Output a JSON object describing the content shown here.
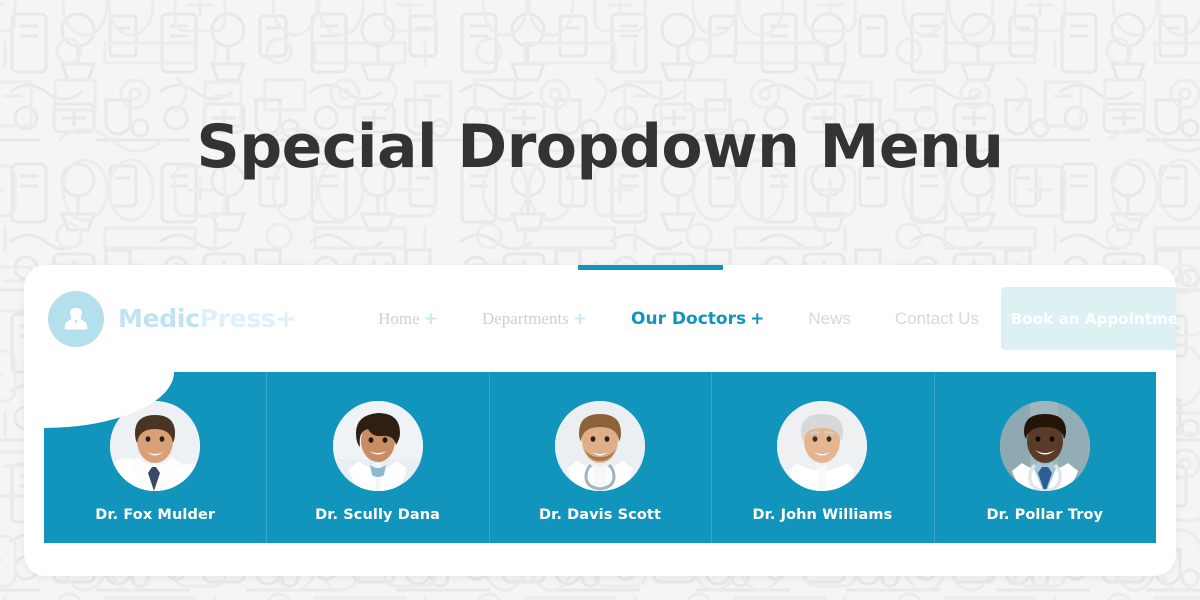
{
  "hero": {
    "title": "Special Dropdown Menu"
  },
  "brand": {
    "icon": "doctor-avatar-icon",
    "name_primary": "Medic",
    "name_secondary": "Press+"
  },
  "nav": {
    "items": [
      {
        "label": "Home",
        "has_plus": true,
        "active": false,
        "style": "serif"
      },
      {
        "label": "Departments",
        "has_plus": true,
        "active": false,
        "style": "serif"
      },
      {
        "label": "Our Doctors",
        "has_plus": true,
        "active": true,
        "style": "sans"
      },
      {
        "label": "News",
        "has_plus": false,
        "active": false,
        "style": "sans"
      },
      {
        "label": "Contact Us",
        "has_plus": false,
        "active": false,
        "style": "sans"
      }
    ],
    "cta_label": "Book an Appointment"
  },
  "dropdown": {
    "doctors": [
      {
        "name": "Dr. Fox Mulder",
        "photo": "male-doctor-brown-hair-suit-tie"
      },
      {
        "name": "Dr. Scully Dana",
        "photo": "female-doctor-dark-hair-labcoat"
      },
      {
        "name": "Dr. Davis Scott",
        "photo": "male-doctor-light-beard-stethoscope"
      },
      {
        "name": "Dr. John Williams",
        "photo": "senior-male-doctor-white-hair"
      },
      {
        "name": "Dr. Pollar Troy",
        "photo": "male-doctor-dark-skin-blue-tie"
      }
    ]
  },
  "colors": {
    "accent_teal": "#1295bd",
    "brand_light_blue": "#b3e0ec",
    "cta_background": "#ddf0f2",
    "page_background": "#f5f5f5",
    "title_color": "#333333",
    "nav_inactive": "#d4d4d4"
  }
}
